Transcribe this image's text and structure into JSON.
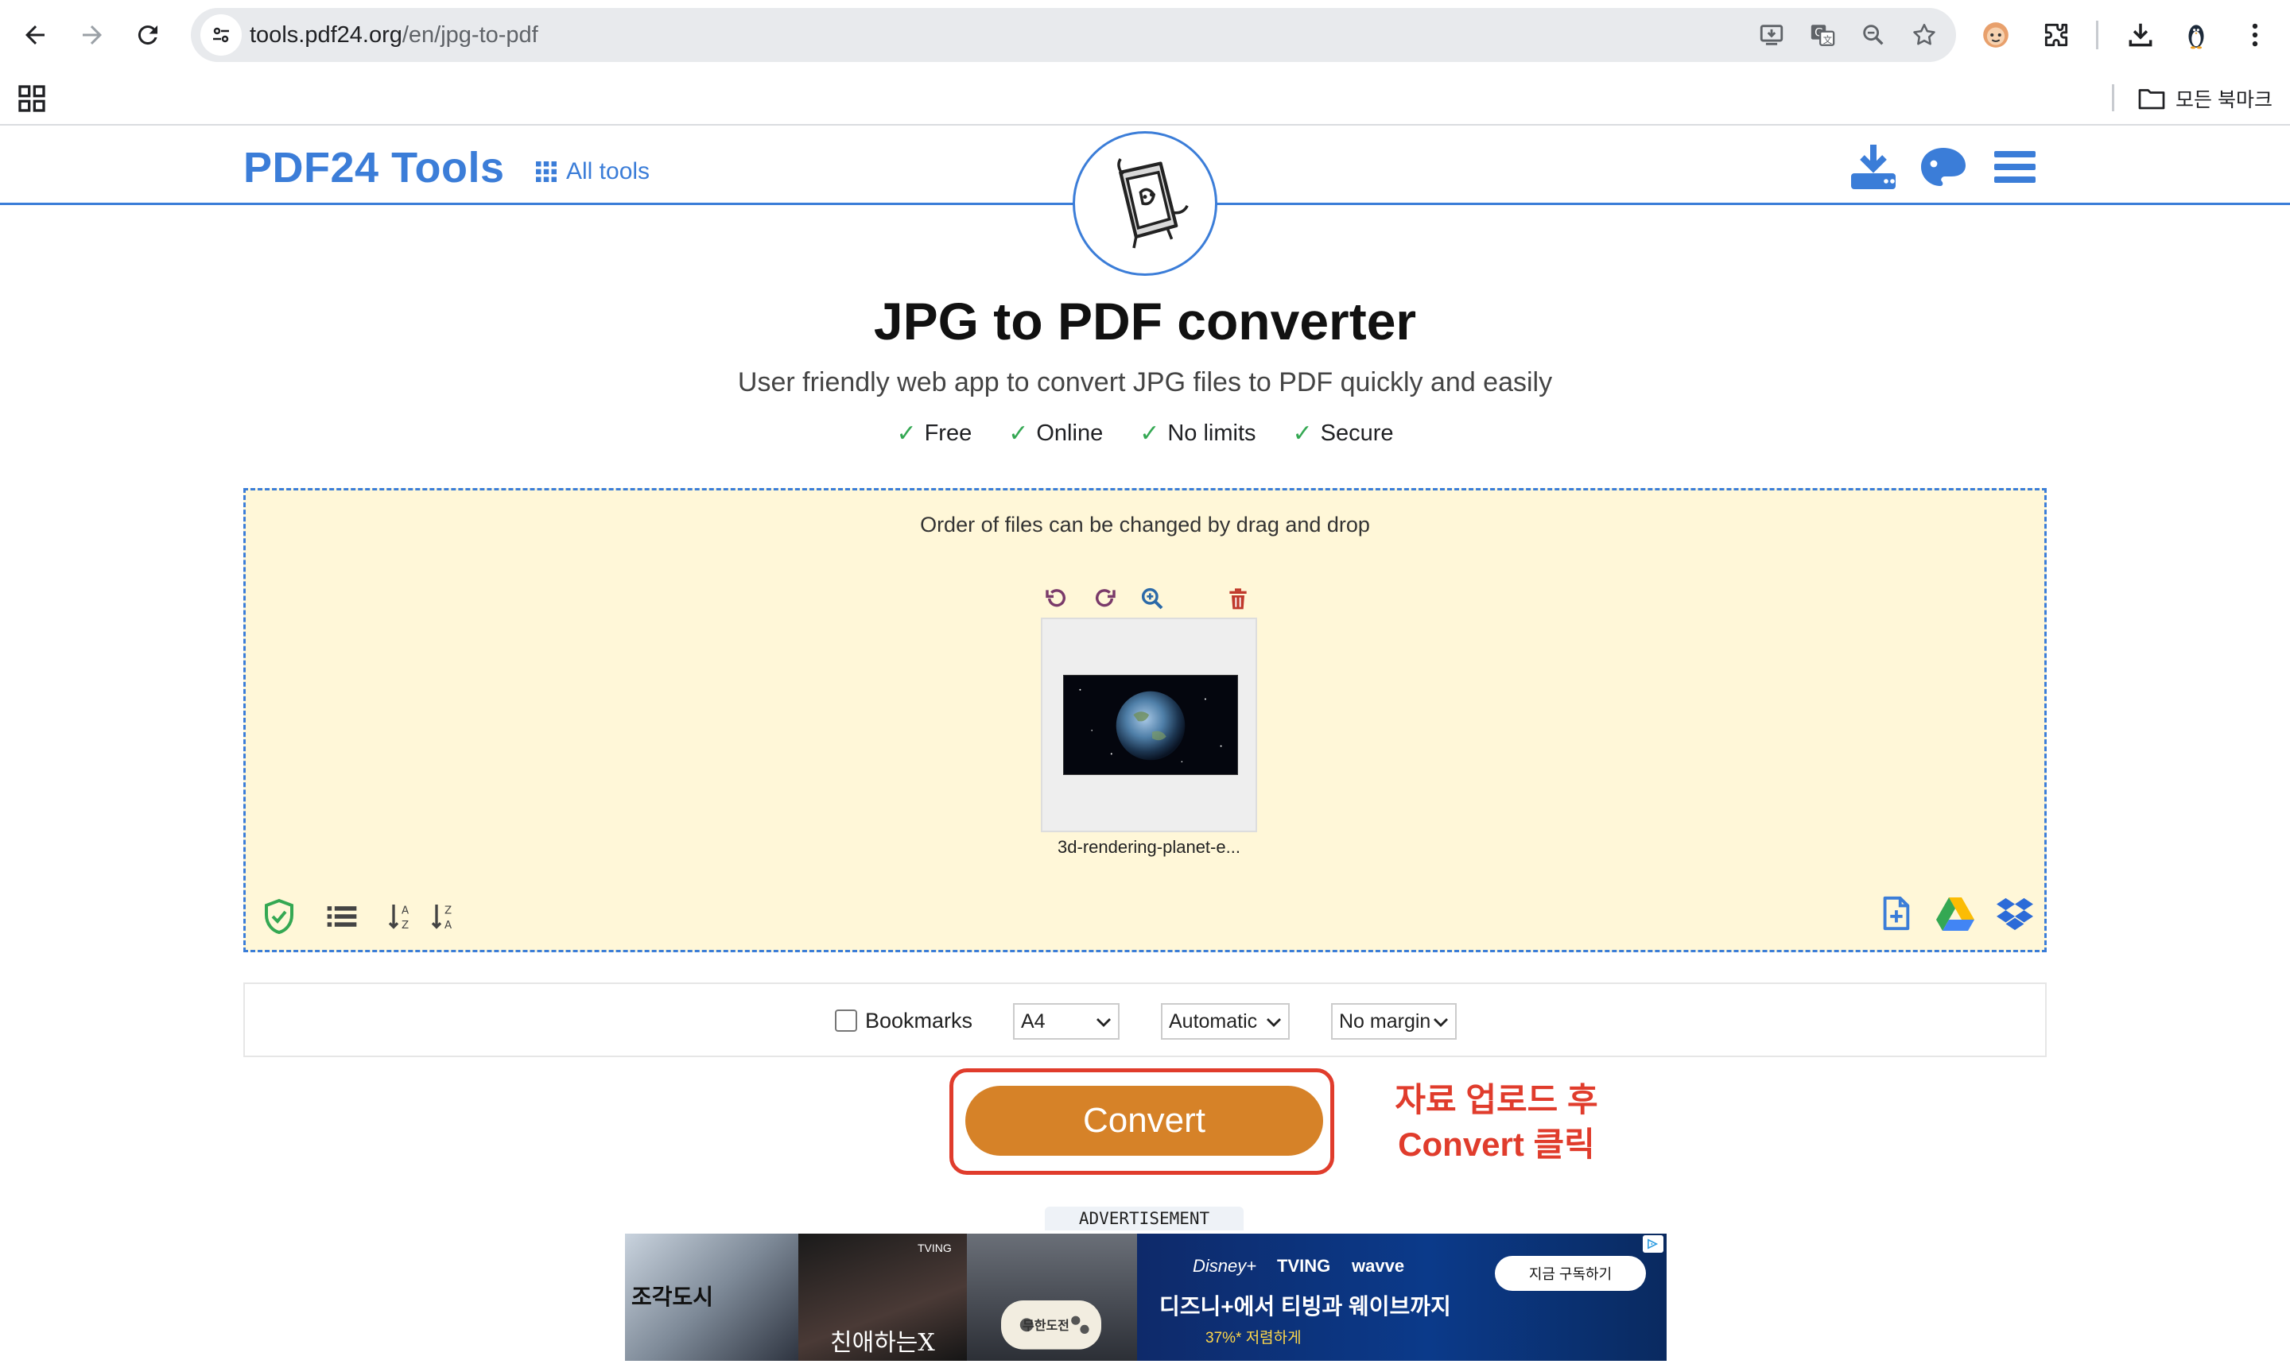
{
  "browser": {
    "url_host": "tools.pdf24.org",
    "url_path": "/en/jpg-to-pdf",
    "bookmark_folder": "모든 북마크"
  },
  "header": {
    "logo": "PDF24 Tools",
    "all_tools": "All tools"
  },
  "hero": {
    "title": "JPG to PDF converter",
    "subtitle": "User friendly web app to convert JPG files to PDF quickly and easily",
    "features": [
      "Free",
      "Online",
      "No limits",
      "Secure"
    ],
    "check": "✓"
  },
  "dropzone": {
    "hint": "Order of files can be changed by drag and drop",
    "file_name": "3d-rendering-planet-e..."
  },
  "options": {
    "bookmarks_label": "Bookmarks",
    "bookmarks_checked": false,
    "page_size": "A4",
    "orientation": "Automatic",
    "margin": "No margin"
  },
  "convert": {
    "label": "Convert"
  },
  "annotation": {
    "line1": "자료 업로드 후",
    "line2": "Convert  클릭"
  },
  "ad": {
    "label": "ADVERTISEMENT",
    "p1_title": "조각도시",
    "p2_title": "친애하는X",
    "p3_title": "무한도전",
    "brand_disney": "Disney+",
    "brand_tving": "TVING",
    "brand_wavve": "wavve",
    "headline": "디즈니+에서 티빙과 웨이브까지",
    "discount": "37%* 저렴하게",
    "subscribe": "지금 구독하기",
    "tag_tving": "TVING"
  },
  "colors": {
    "brand_blue": "#3b7dd8",
    "dropzone_bg": "#fff7d8",
    "convert_orange": "#d68228",
    "annotation_red": "#e03c2c",
    "check_green": "#34a853"
  }
}
